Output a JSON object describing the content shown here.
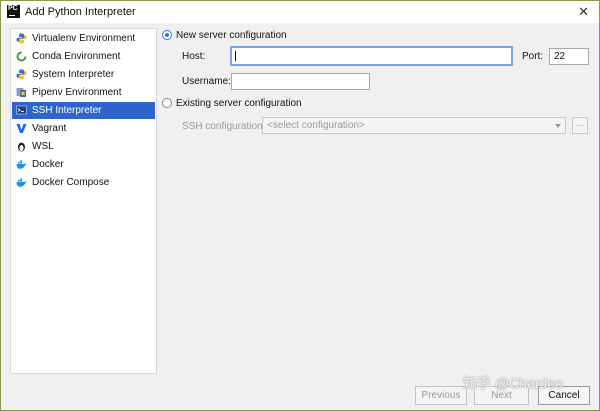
{
  "window": {
    "title": "Add Python Interpreter"
  },
  "sidebar": {
    "items": [
      {
        "label": "Virtualenv Environment"
      },
      {
        "label": "Conda Environment"
      },
      {
        "label": "System Interpreter"
      },
      {
        "label": "Pipenv Environment"
      },
      {
        "label": "SSH Interpreter"
      },
      {
        "label": "Vagrant"
      },
      {
        "label": "WSL"
      },
      {
        "label": "Docker"
      },
      {
        "label": "Docker Compose"
      }
    ],
    "selected": "SSH Interpreter"
  },
  "new_server": {
    "label": "New server configuration",
    "host_label": "Host:",
    "host_value": "",
    "port_label": "Port:",
    "port_value": "22",
    "username_label": "Username:",
    "username_value": ""
  },
  "existing_server": {
    "label": "Existing server configuration",
    "ssh_config_label": "SSH configuration:",
    "ssh_config_placeholder": "<select configuration>",
    "browse_label": "..."
  },
  "buttons": {
    "previous": "Previous",
    "next": "Next",
    "cancel": "Cancel"
  },
  "watermark": "知乎 @Chardeo",
  "colors": {
    "selection": "#2f65ca",
    "focus": "#7aa7e8",
    "radio": "#3a78d8"
  }
}
